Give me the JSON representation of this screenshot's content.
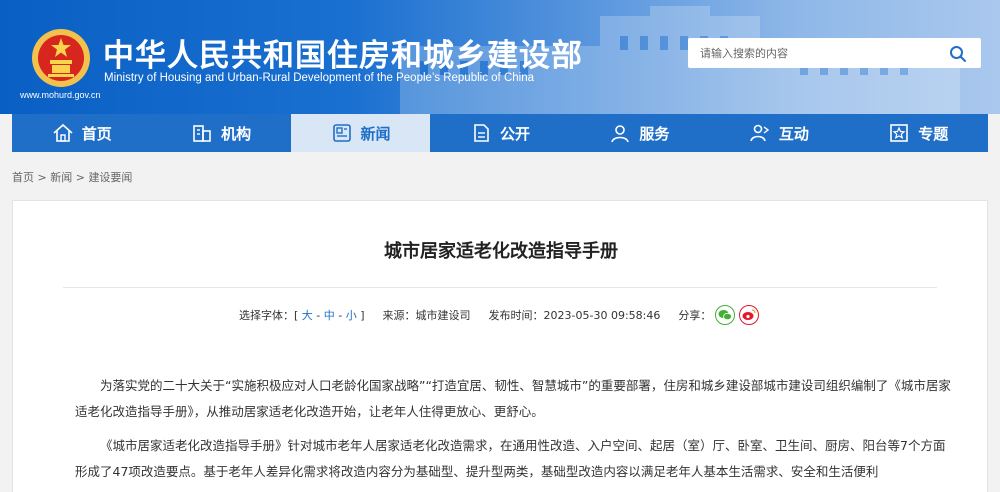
{
  "header": {
    "title": "中华人民共和国住房和城乡建设部",
    "subtitle": "Ministry of Housing and Urban-Rural Development of the People’s Republic of China",
    "url": "www.mohurd.gov.cn",
    "search_placeholder": "请输入搜索的内容"
  },
  "nav": {
    "items": [
      {
        "label": "首页",
        "icon": "home-icon"
      },
      {
        "label": "机构",
        "icon": "building-icon"
      },
      {
        "label": "新闻",
        "icon": "news-icon",
        "active": true
      },
      {
        "label": "公开",
        "icon": "document-icon"
      },
      {
        "label": "服务",
        "icon": "user-service-icon"
      },
      {
        "label": "互动",
        "icon": "interaction-icon"
      },
      {
        "label": "专题",
        "icon": "star-icon"
      }
    ]
  },
  "breadcrumb": [
    "首页",
    "新闻",
    "建设要闻"
  ],
  "article": {
    "title": "城市居家适老化改造指导手册",
    "font_label": "选择字体：",
    "font_open": "[",
    "font_large": "大",
    "font_medium": "中",
    "font_small": "小",
    "font_close": "]",
    "source_label": "来源：",
    "source": "城市建设司",
    "date_label": "发布时间：",
    "date": "2023-05-30 09:58:46",
    "share_label": "分享：",
    "paragraphs": [
      "为落实党的二十大关于“实施积极应对人口老龄化国家战略”“打造宜居、韧性、智慧城市”的重要部署，住房和城乡建设部城市建设司组织编制了《城市居家适老化改造指导手册》，从推动居家适老化改造开始，让老年人住得更放心、更舒心。",
      "《城市居家适老化改造指导手册》针对城市老年人居家适老化改造需求，在通用性改造、入户空间、起居（室）厅、卧室、卫生间、厨房、阳台等7个方面形成了47项改造要点。基于老年人差异化需求将改造内容分为基础型、提升型两类，基础型改造内容以满足老年人基本生活需求、安全和生活便利"
    ]
  },
  "colors": {
    "nav_bg": "#1f6fc9",
    "nav_active_bg": "#d8e6f6",
    "link": "#1f6fc9"
  }
}
